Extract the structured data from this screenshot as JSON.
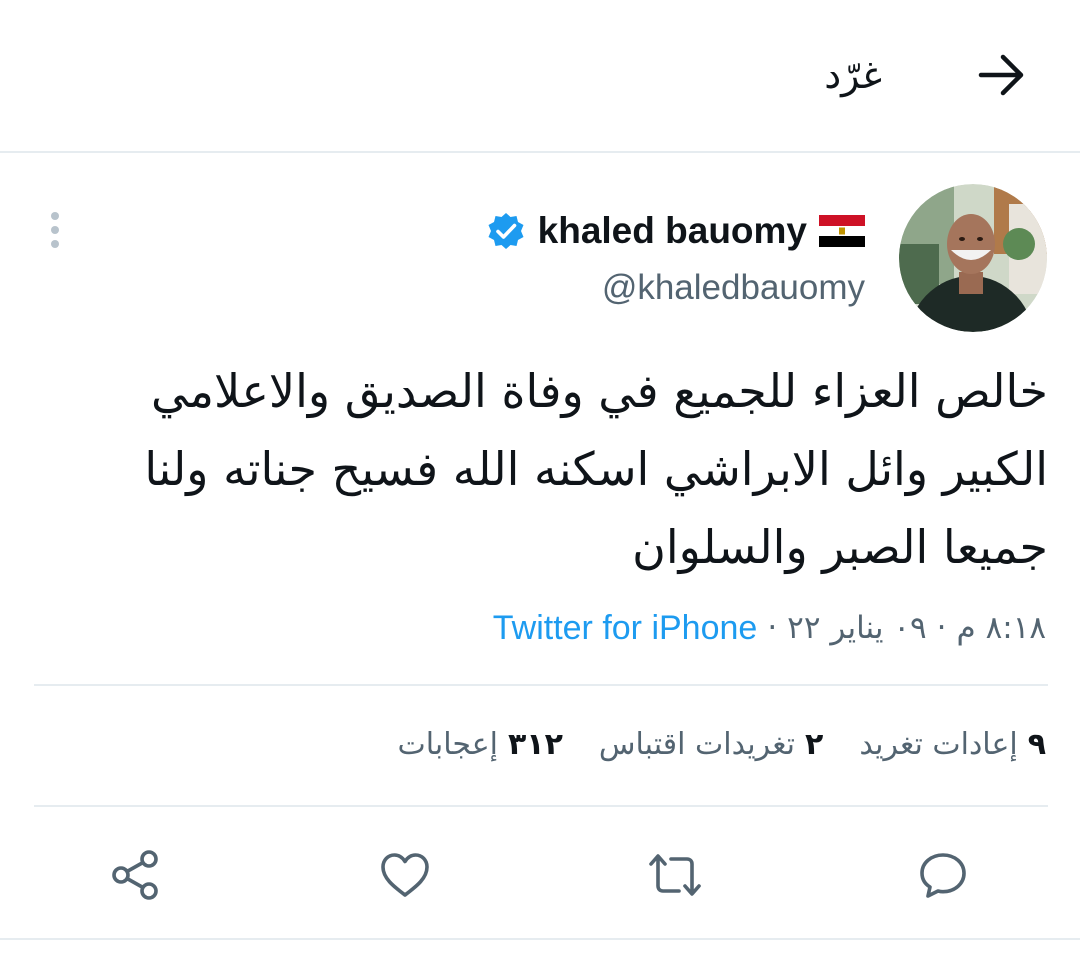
{
  "header": {
    "title": "غرّد",
    "back_icon": "arrow-right-icon"
  },
  "author": {
    "display_name": "khaled bauomy",
    "flag": "🇪🇬",
    "handle": "@khaledbauomy",
    "verified": true,
    "verified_color": "#1d9bf0"
  },
  "tweet": {
    "lines": [
      "خالص العزاء للجميع في وفاة الصديق والاعلامي",
      "الكبير وائل الابراشي اسكنه الله فسيح جناته ولنا",
      "جميعا الصبر والسلوان"
    ],
    "time": "٨:١٨ م",
    "date": "٠٩ يناير ٢٢",
    "separator": "·",
    "source": "Twitter for iPhone",
    "source_color": "#1d9bf0"
  },
  "stats": [
    {
      "count": "٩",
      "label": "إعادات تغريد"
    },
    {
      "count": "٢",
      "label": "تغريدات اقتباس"
    },
    {
      "count": "٣١٢",
      "label": "إعجابات"
    }
  ],
  "actions": {
    "reply_icon": "reply-icon",
    "retweet_icon": "retweet-icon",
    "like_icon": "heart-icon",
    "share_icon": "share-icon"
  },
  "colors": {
    "text": "#0f1419",
    "secondary": "#536471",
    "divider": "#e6ecf0",
    "accent": "#1d9bf0"
  }
}
